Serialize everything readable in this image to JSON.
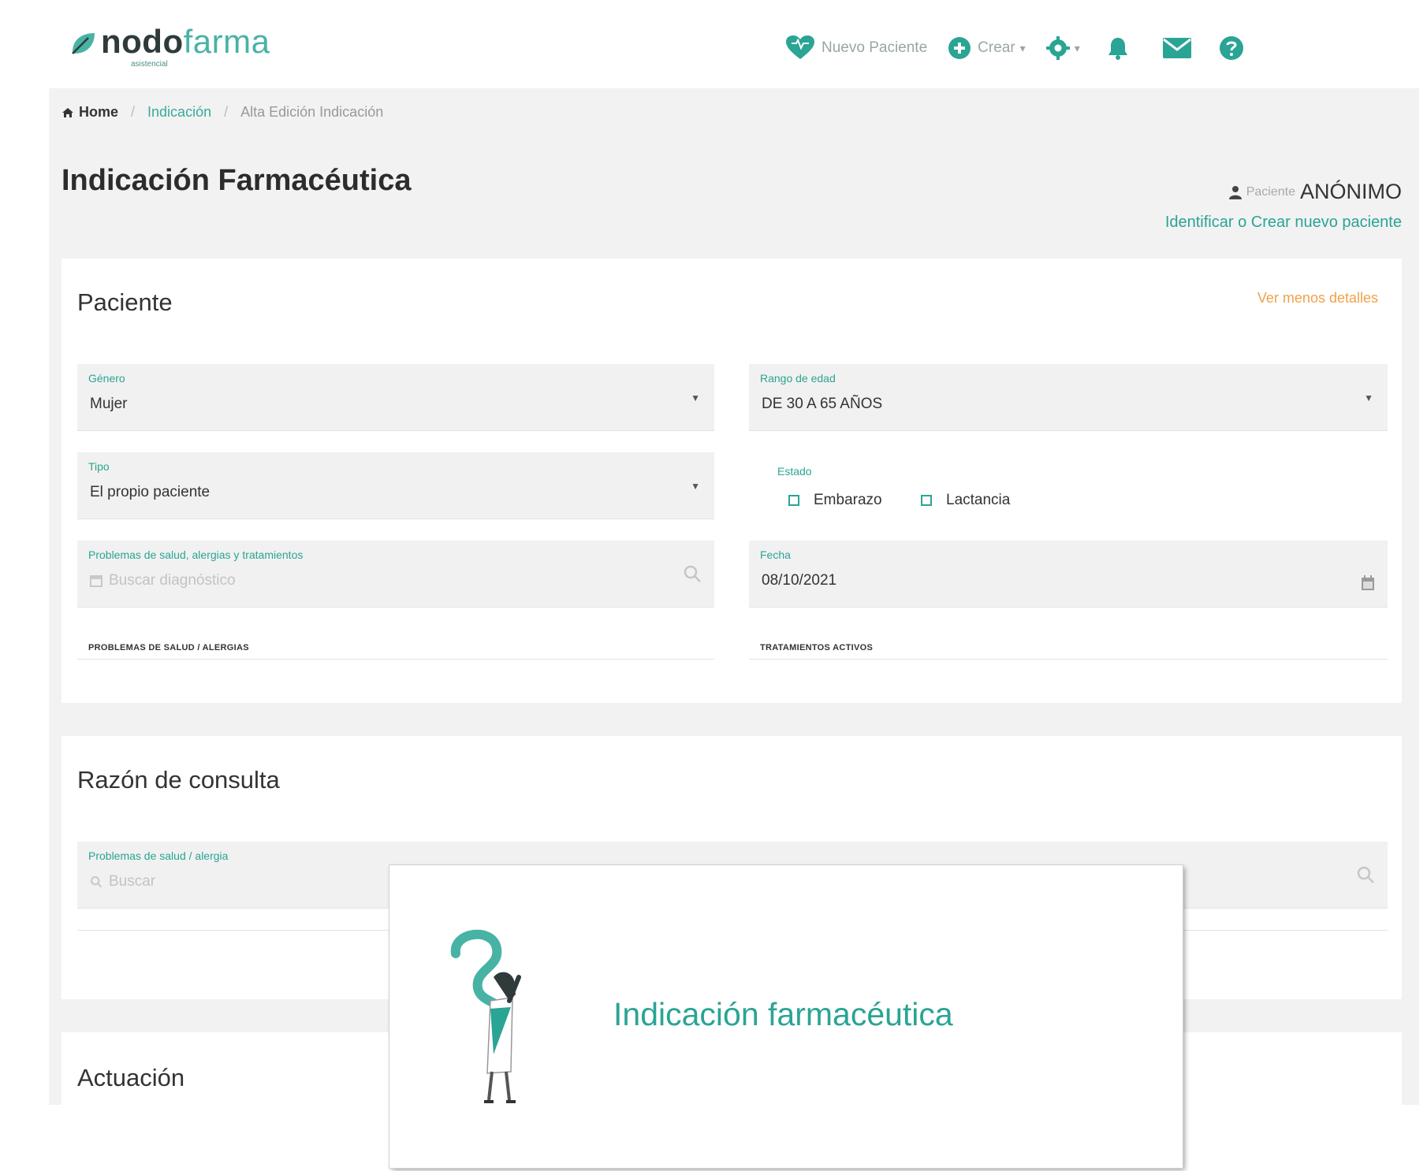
{
  "brand": {
    "name_bold": "nodo",
    "name_light": "farma",
    "subtitle": "asistencial"
  },
  "nav": {
    "new_patient_label": "Nuevo Paciente",
    "create_label": "Crear",
    "create_caret": "▾",
    "settings_caret": "▾"
  },
  "breadcrumb": {
    "home": "Home",
    "section": "Indicación",
    "current": "Alta Edición Indicación",
    "separator": "/"
  },
  "page": {
    "title": "Indicación Farmacéutica",
    "patient_label": "Paciente",
    "patient_value": "ANÓNIMO",
    "patient_link": "Identificar o Crear nuevo paciente"
  },
  "patient_card": {
    "title": "Paciente",
    "more_link": "Ver menos detalles",
    "gender": {
      "label": "Género",
      "value": "Mujer"
    },
    "age_range": {
      "label": "Rango de edad",
      "value": "DE 30 A 65 AÑOS"
    },
    "type": {
      "label": "Tipo",
      "value": "El propio paciente"
    },
    "state": {
      "label": "Estado",
      "option1": "Embarazo",
      "option2": "Lactancia"
    },
    "health_problems": {
      "label": "Problemas de salud, alergias y tratamientos",
      "placeholder": "Buscar diagnóstico"
    },
    "date": {
      "label": "Fecha",
      "value": "08/10/2021"
    },
    "section_left": "PROBLEMAS DE SALUD / ALERGIAS",
    "section_right": "TRATAMIENTOS ACTIVOS"
  },
  "reason_card": {
    "title": "Razón de consulta",
    "field": {
      "label": "Problemas de salud / alergia",
      "placeholder": "Buscar"
    }
  },
  "action_card": {
    "title": "Actuación"
  },
  "modal": {
    "title": "Indicación farmacéutica"
  },
  "colors": {
    "accent": "#2aa494",
    "accent_light": "#48b3a5",
    "warning": "#f0a24a",
    "background": "#f2f2f2"
  }
}
